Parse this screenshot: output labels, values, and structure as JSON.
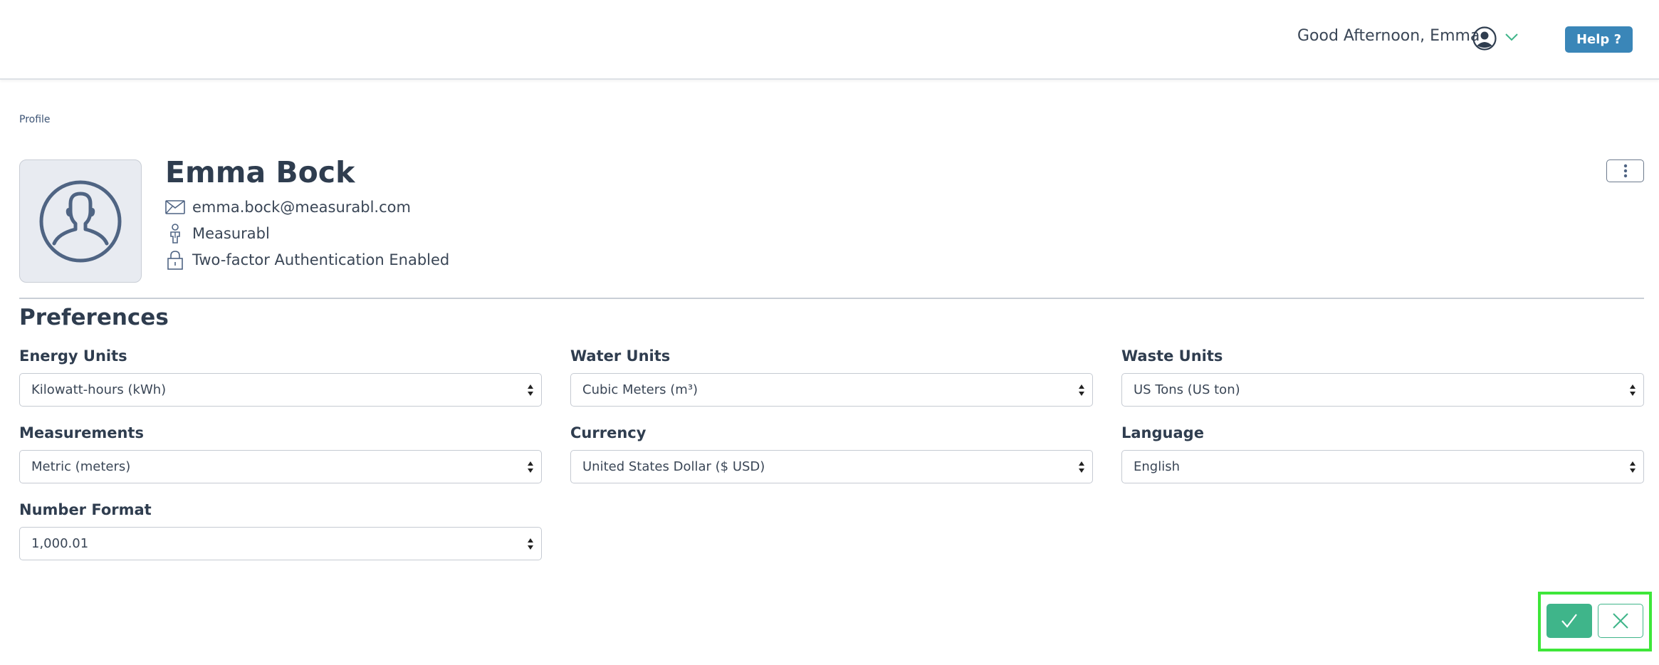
{
  "header": {
    "greeting": "Good Afternoon, Emma",
    "help_label": "Help ?",
    "colors": {
      "help_bg": "#3a86b8",
      "accent": "#3fb58a"
    }
  },
  "breadcrumb": "Profile",
  "profile": {
    "name": "Emma Bock",
    "email": "emma.bock@measurabl.com",
    "organization": "Measurabl",
    "security": "Two-factor Authentication Enabled"
  },
  "preferences": {
    "title": "Preferences",
    "energy_units": {
      "label": "Energy Units",
      "value": "Kilowatt-hours (kWh)"
    },
    "water_units": {
      "label": "Water Units",
      "value": "Cubic Meters (m³)"
    },
    "waste_units": {
      "label": "Waste Units",
      "value": "US Tons (US ton)"
    },
    "measurements": {
      "label": "Measurements",
      "value": "Metric (meters)"
    },
    "currency": {
      "label": "Currency",
      "value": "United States Dollar ($ USD)"
    },
    "language": {
      "label": "Language",
      "value": "English"
    },
    "number_format": {
      "label": "Number Format",
      "value": "1,000.01"
    }
  },
  "icons": {
    "user": "user-circle-icon",
    "chevron": "chevron-down-icon",
    "email": "envelope-icon",
    "org": "person-icon",
    "lock": "lock-icon",
    "more": "kebab-icon",
    "confirm": "check-icon",
    "cancel": "close-icon"
  }
}
